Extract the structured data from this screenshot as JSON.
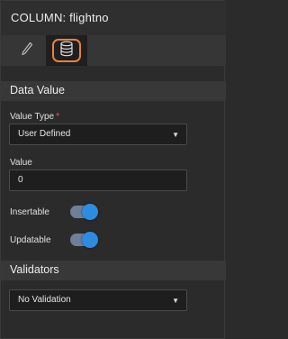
{
  "header": {
    "title": "COLUMN: flightno"
  },
  "tabs": [
    {
      "icon": "pencil-icon",
      "selected": false
    },
    {
      "icon": "database-icon",
      "selected": true
    }
  ],
  "data_value": {
    "section_title": "Data Value",
    "value_type": {
      "label": "Value Type",
      "required_mark": "*",
      "selected": "User Defined"
    },
    "value": {
      "label": "Value",
      "current": "0"
    },
    "insertable": {
      "label": "Insertable",
      "on": true
    },
    "updatable": {
      "label": "Updatable",
      "on": true
    }
  },
  "validators": {
    "section_title": "Validators",
    "selected": "No Validation"
  },
  "colors": {
    "accent_toggle": "#2d8ce0",
    "highlight_ring": "#e8823a",
    "required": "#e85a5a"
  }
}
